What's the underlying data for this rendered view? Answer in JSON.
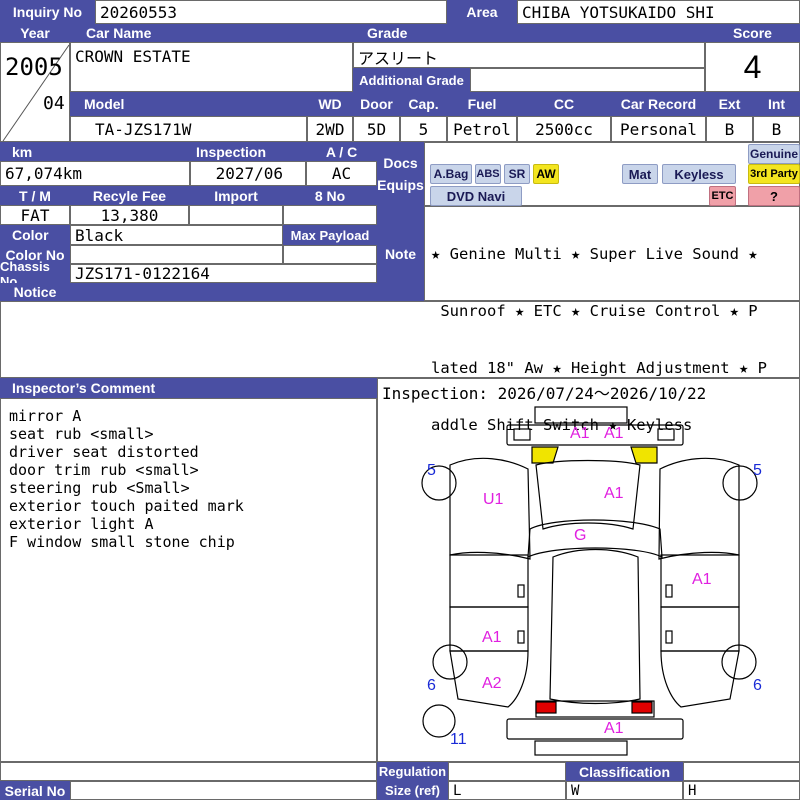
{
  "header": {
    "inquiry_label": "Inquiry No",
    "inquiry_no": "20260553",
    "area_label": "Area",
    "area": "CHIBA YOTSUKAIDO SHI"
  },
  "labels": {
    "year": "Year",
    "car_name": "Car Name",
    "grade": "Grade",
    "score": "Score",
    "additional_grade": "Additional Grade",
    "model": "Model",
    "wd": "WD",
    "door": "Door",
    "cap": "Cap.",
    "fuel": "Fuel",
    "cc": "CC",
    "car_record": "Car Record",
    "ext": "Ext",
    "int": "Int",
    "km": "km",
    "inspection": "Inspection",
    "ac": "A / C",
    "docs": "Docs",
    "equips": "Equips",
    "tm": "T / M",
    "recycle_fee": "Recyle Fee",
    "import": "Import",
    "eight_no": "8 No",
    "color": "Color",
    "max_payload": "Max Payload",
    "color_no": "Color No",
    "note": "Note",
    "chassis_no": "Chassis No",
    "notice": "Notice",
    "inspectors_comment": "Inspector’s Comment",
    "regulation": "Regulation",
    "classification": "Classification",
    "size_ref": "Size (ref)",
    "serial_no": "Serial No",
    "size_l": "L",
    "size_w": "W",
    "size_h": "H"
  },
  "vehicle": {
    "year": "2005",
    "month": "04",
    "car_name": "CROWN ESTATE",
    "grade": "アスリート",
    "additional_grade": "",
    "score": "4",
    "model": "TA-JZS171W",
    "wd": "2WD",
    "door": "5D",
    "cap": "5",
    "fuel": "Petrol",
    "cc": "2500cc",
    "car_record": "Personal",
    "ext": "B",
    "int": "B",
    "km": "67,074km",
    "inspection": "2027/06",
    "ac": "AC",
    "tm": "FAT",
    "recycle_fee": "13,380",
    "import": "",
    "eight_no": "",
    "color": "Black",
    "max_payload": "",
    "color_no": "",
    "chassis_no": "JZS171-0122164",
    "notice": "",
    "serial_no": ""
  },
  "equips": {
    "abag": "A.Bag",
    "abs": "ABS",
    "sr": "SR",
    "aw": "AW",
    "mat": "Mat",
    "keyless": "Keyless",
    "genuine": "Genuine",
    "third_party": "3rd Party",
    "dvd_navi": "DVD Navi",
    "etc": "ETC",
    "unknown": "?"
  },
  "note": {
    "line1": "★ Genine Multi ★ Super Live Sound ★",
    "line2": " Sunroof ★ ETC ★ Cruise Control ★ P",
    "line3": "lated 18\" Aw ★ Height Adjustment ★ P",
    "line4": "addle Shift Switch ★ Keyless"
  },
  "inspection_period": "Inspection: 2026/07/24～2026/10/22",
  "comments": [
    "mirror A",
    "seat rub <small>",
    "driver seat distorted",
    "door trim rub <small>",
    "steering rub <Small>",
    "exterior touch paited mark",
    "exterior light A",
    "F window small stone chip"
  ],
  "diagram_marks": {
    "front_left": "A1",
    "front_right": "A1",
    "hood": "A1",
    "left_front_fender": "U1",
    "windshield": "G",
    "right_side": "A1",
    "left_rear_door": "A1",
    "left_rear_quarter": "A2",
    "rear": "A1",
    "num_5_left": "5",
    "num_5_right": "5",
    "num_6_left": "6",
    "num_6_right": "6",
    "num_11": "11"
  },
  "colors": {
    "header_bg": "#4a4fa3",
    "mark_magenta": "#e020e0",
    "mark_blue": "#1a2bd6",
    "badge_blue": "#c9d5ea",
    "badge_yellow": "#f3e51f",
    "badge_pink": "#f0a0a8"
  }
}
